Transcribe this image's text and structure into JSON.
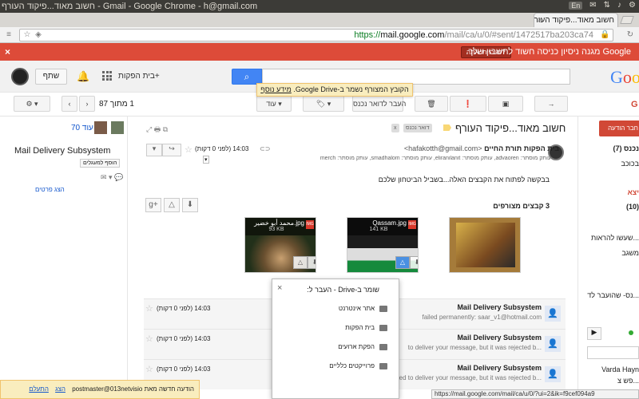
{
  "os": {
    "window_title": "חשוב מאוד...פיקוד העורף - Gmail - Google Chrome - h@gmail.com",
    "lang": "En"
  },
  "browser": {
    "tab_title": "חשוב מאוד...פיקוד העורף",
    "url_scheme": "https://",
    "url_host": "mail.google.com",
    "url_path": "/mail/ca/u/0/#sent/1472517ba203ca74"
  },
  "banner": {
    "message": "Google מגנה ניסיון כניסה חשוד לחשבון שלך.",
    "button": "זה הייתי אתה?",
    "close": "×"
  },
  "header": {
    "logo_g1": "G",
    "logo_o1": "o",
    "logo_o2": "o",
    "plus_link": "+בית הפקות",
    "share": "שתף"
  },
  "toast": {
    "message": "הקובץ המצורף נשמר ב-Google Drive.",
    "link": "מידע נוסף"
  },
  "toolbar": {
    "move_drive": "העבר לדואר נכנס",
    "more": "עוד",
    "pager": "1 מתוך 87"
  },
  "compose": {
    "label": "חבר הודעה"
  },
  "people": {
    "more": "עוד 70",
    "name": "Mail Delivery Subsystem",
    "add_contact": "הוסף למעגלים",
    "details": "הצג פרטים"
  },
  "thread": {
    "subject": "חשוב מאוד...פיקוד העורף",
    "label_inbox": "דואר נכנס",
    "label_x": "x",
    "sender_name": "בית הפקות תורת החיים",
    "sender_addr": "<hafakotth@gmail.com>",
    "time": "14:03 (לפני 0 דקות)",
    "recipients": "עותק מוסתר: advaoren, עותק מוסתר: eliranilanit, עותק מוסתר: smadhalom, עותק מוסתר: merch",
    "body": "בבקשה לפתוח את הקבצים האלה...בשביל הביטחון שלכם",
    "attachments_count": "3 קבצים מצורפים"
  },
  "attachments": [
    {
      "name": "",
      "size": "",
      "bg": "#a57b3a"
    },
    {
      "name": "Qassam.jpg",
      "size": "141 KB",
      "bg": "#2b2b2b"
    },
    {
      "name": "محمد أبو خضير.jpg",
      "size": "93 KB",
      "bg": "#3a4a2a"
    }
  ],
  "drive_popup": {
    "title": "שומר ב-Drive - העבר ל:",
    "items": [
      "אתר אינטרנט",
      "בית הפקות",
      "הפקת ארועים",
      "פרוייקטים כלליים"
    ]
  },
  "messages": [
    {
      "who": "Mail Delivery Subsystem",
      "snippet": "failed permanently: saar_v1@hotmail.com",
      "time": "14:03 (לפני 0 דקות)"
    },
    {
      "who": "Mail Delivery Subsystem",
      "snippet": "to deliver your message, but it was rejected b...",
      "time": "14:03 (לפני 0 דקות)"
    },
    {
      "who": "Mail Delivery Subsystem",
      "snippet": "tried to deliver your message, but it was rejected b...",
      "time": "14:03 (לפני 0 דקות)"
    }
  ],
  "right_sidebar": {
    "inbox": "נכנס (7)",
    "starred": "בכוכב",
    "sent": "יצא",
    "count10": "(10)",
    "item1": "...שעשו להראות",
    "item2": "משגב",
    "item3": "...נס- שהועבר לד",
    "contact": "Varda Hayn",
    "contact2": "...פש צ"
  },
  "notification": {
    "text": "הודעה חדשה מאת postmaster@013netvisio",
    "show": "הצג",
    "ignore": "התעלם"
  },
  "status_url": "https://mail.google.com/mail/ca/u/0/?ui=2&ik=f9cef094a9"
}
